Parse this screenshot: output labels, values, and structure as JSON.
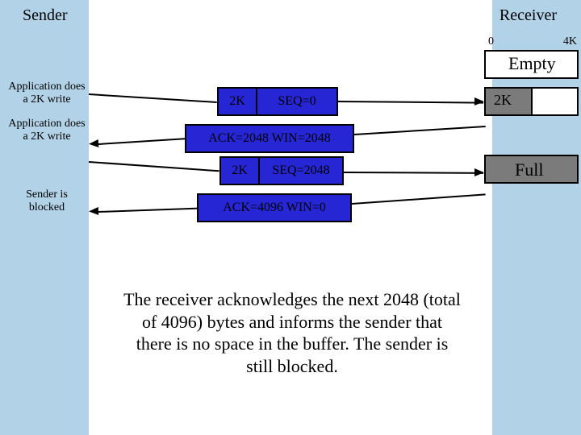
{
  "titles": {
    "sender": "Sender",
    "receiver": "Receiver"
  },
  "axis": {
    "left": "0",
    "right": "4K"
  },
  "buffers": {
    "empty": "Empty",
    "half": "2K",
    "full": "Full"
  },
  "messages": {
    "seq0_size": "2K",
    "seq0_label": "SEQ=0",
    "ack1": "ACK=2048 WIN=2048",
    "seq2_size": "2K",
    "seq2_label": "SEQ=2048",
    "ack2": "ACK=4096 WIN=0"
  },
  "events": {
    "e1": "Application does a 2K write",
    "e2": "Application does a 2K write",
    "e3": "Sender is blocked"
  },
  "caption": "The receiver acknowledges the next 2048 (total of 4096) bytes and informs the sender that there is no space in the buffer. The sender is still blocked.",
  "chart_data": {
    "type": "table",
    "title": "TCP sliding-window flow control — sender/receiver message sequence",
    "buffer_capacity_bytes": 4096,
    "events": [
      {
        "side": "sender",
        "action": "Application does a 2K write"
      },
      {
        "dir": "sender→receiver",
        "segment_size_bytes": 2048,
        "header": "SEQ=0",
        "receiver_buffer_after": {
          "used_bytes": 2048,
          "free_bytes": 2048,
          "label": "2K"
        }
      },
      {
        "dir": "receiver→sender",
        "header": "ACK=2048 WIN=2048"
      },
      {
        "side": "sender",
        "action": "Application does a 2K write"
      },
      {
        "dir": "sender→receiver",
        "segment_size_bytes": 2048,
        "header": "SEQ=2048",
        "receiver_buffer_after": {
          "used_bytes": 4096,
          "free_bytes": 0,
          "label": "Full"
        }
      },
      {
        "dir": "receiver→sender",
        "header": "ACK=4096 WIN=0"
      },
      {
        "side": "sender",
        "action": "Sender is blocked"
      }
    ],
    "buffer_states": [
      {
        "label": "Empty",
        "used_bytes": 0
      },
      {
        "label": "2K",
        "used_bytes": 2048
      },
      {
        "label": "Full",
        "used_bytes": 4096
      }
    ]
  }
}
